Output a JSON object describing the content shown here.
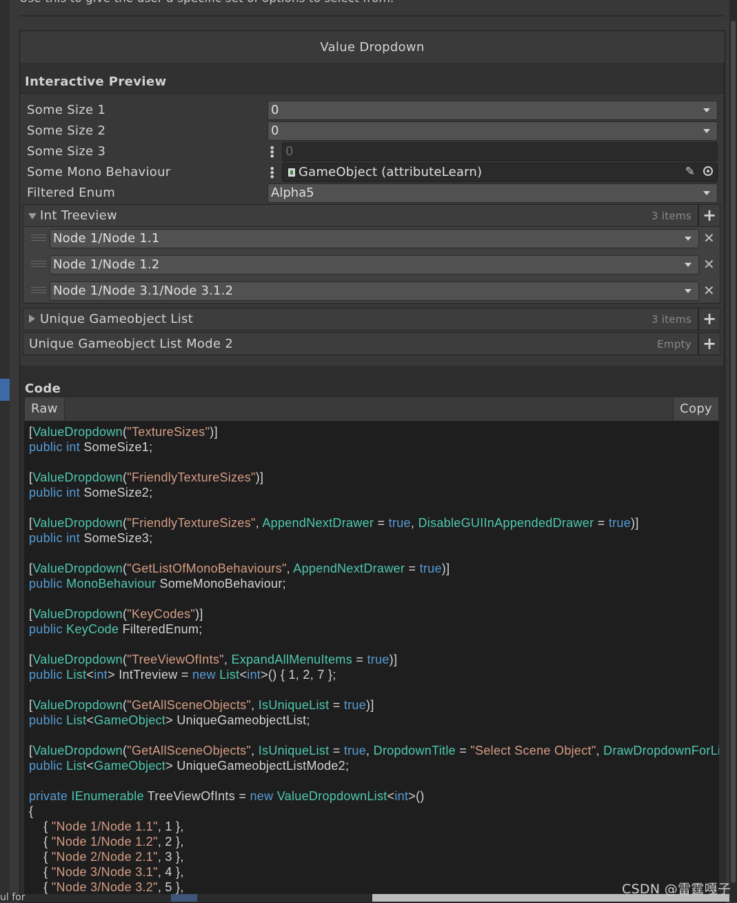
{
  "top_cut_text": "Use this to give the user a specific set of options to select from.",
  "window_title": "Value Dropdown",
  "preview": {
    "title": "Interactive Preview",
    "fields": [
      {
        "label": "Some Size 1",
        "value": "0"
      },
      {
        "label": "Some Size 2",
        "value": "0"
      },
      {
        "label": "Some Size 3",
        "value": "0"
      },
      {
        "label": "Some Mono Behaviour",
        "value": "GameObject (attributeLearn)"
      },
      {
        "label": "Filtered Enum",
        "value": "Alpha5"
      }
    ],
    "int_treeview": {
      "title": "Int Treeview",
      "count": "3 items",
      "items": [
        "Node 1/Node 1.1",
        "Node 1/Node 1.2",
        "Node 1/Node 3.1/Node 3.1.2"
      ]
    },
    "unique_list": {
      "title": "Unique Gameobject List",
      "count": "3 items"
    },
    "unique_list_mode2": {
      "title": "Unique Gameobject List Mode 2",
      "count": "Empty"
    }
  },
  "code": {
    "title": "Code",
    "tab_raw": "Raw",
    "copy_label": "Copy"
  },
  "bottom_text": "ul for",
  "watermark": "CSDN @雷霆嘎子",
  "colors": {
    "keyword": "#569cd6",
    "type": "#4ec9b0",
    "string": "#d69d85",
    "accent": "#3d6aa8"
  }
}
